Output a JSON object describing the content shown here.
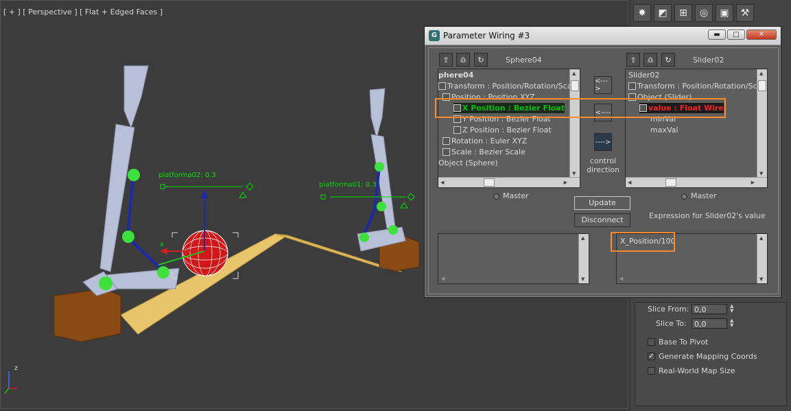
{
  "viewport": {
    "label": "[ + ] [ Perspective ] [ Flat + Edged Faces ]",
    "gizmo_labels": [
      "platforma02: 0.3",
      "platforma01: 0.3"
    ],
    "axis_labels": {
      "x": "x",
      "z": "z"
    }
  },
  "command_panel": {
    "tabs": [
      "create-icon",
      "modify-icon",
      "hierarchy-icon",
      "motion-icon",
      "display-icon",
      "utilities-icon"
    ],
    "slice_from_label": "Slice From:",
    "slice_from_value": "0,0",
    "slice_to_label": "Slice To:",
    "slice_to_value": "0,0",
    "base_to_pivot": "Base To Pivot",
    "generate_mapping": "Generate Mapping Coords",
    "real_world": "Real-World Map Size"
  },
  "dialog": {
    "title": "Parameter Wiring #3",
    "left": {
      "name": "Sphere04",
      "items": [
        "phere04",
        "Transform : Position/Rotation/Scale",
        "Position : Position XYZ",
        "X Position : Bezier Float",
        "Y Position : Bezier Float",
        "Z Position : Bezier Float",
        "Rotation : Euler XYZ",
        "Scale : Bezier Scale",
        "Object (Sphere)"
      ],
      "master": "Master"
    },
    "right": {
      "name": "Slider02",
      "items": [
        "Slider02",
        "Transform : Position/Rotation/Scale",
        "Object (Slider)",
        "value : Float Wire",
        "minVal",
        "maxVal"
      ],
      "master": "Master"
    },
    "arrow_right": "<--->",
    "arrow_left": "<----",
    "arrow_dir": "---->",
    "control_direction": "control\ndirection",
    "update": "Update",
    "disconnect": "Disconnect",
    "expression_label": "Expression for Slider02's value",
    "expression_value": "X_Position/100"
  },
  "colors": {
    "highlight": "#ff8a2a",
    "selected_green": "#00c000",
    "selected_red": "#ff2020"
  }
}
